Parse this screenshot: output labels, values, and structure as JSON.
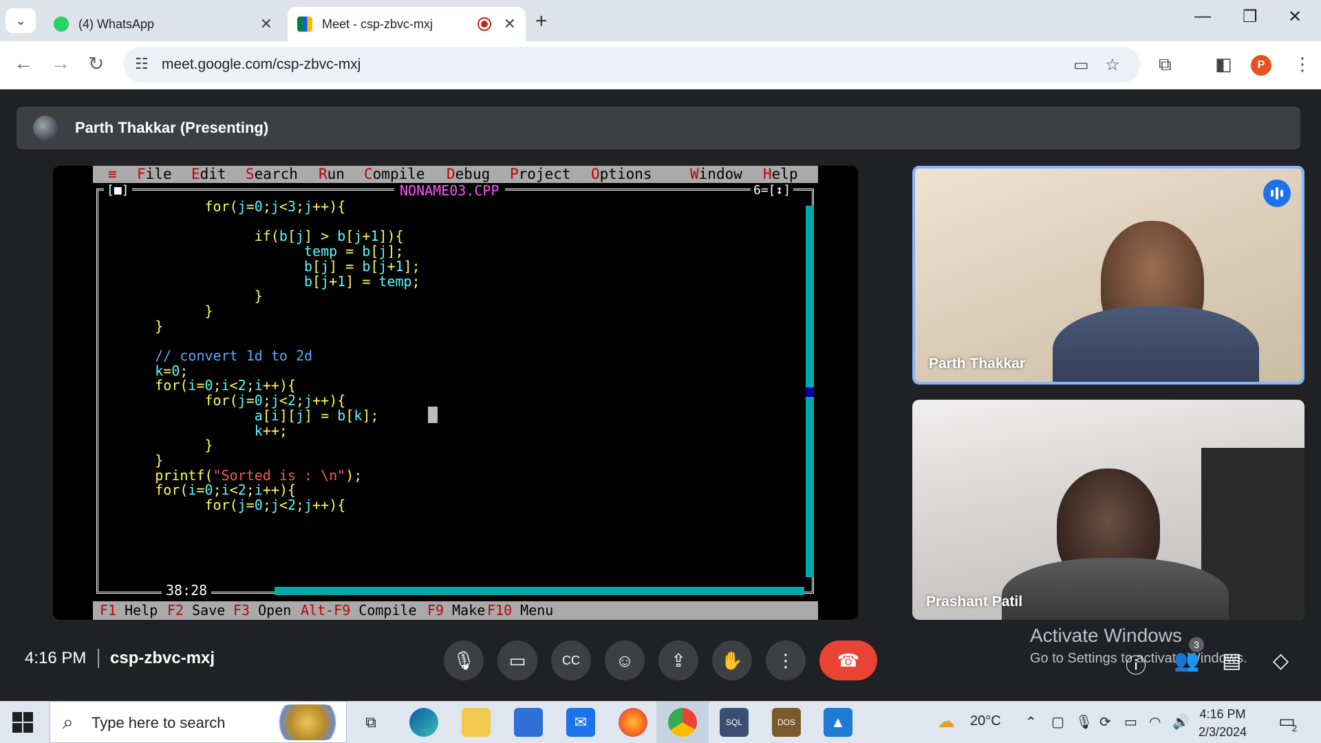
{
  "browser": {
    "tabs": [
      {
        "title": "(4) WhatsApp",
        "active": false
      },
      {
        "title": "Meet - csp-zbvc-mxj",
        "active": true
      }
    ],
    "url": "meet.google.com/csp-zbvc-mxj",
    "profile_initial": "P"
  },
  "meet": {
    "presenter_label": "Parth Thakkar (Presenting)",
    "time": "4:16 PM",
    "code": "csp-zbvc-mxj",
    "participants": [
      {
        "name": "Parth Thakkar",
        "speaking": true
      },
      {
        "name": "Prashant Patil",
        "speaking": false
      }
    ],
    "people_count": "3",
    "watermark_line1": "Activate Windows",
    "watermark_line2": "Go to Settings to activate Windows."
  },
  "ide": {
    "menu": [
      "≡",
      "File",
      "Edit",
      "Search",
      "Run",
      "Compile",
      "Debug",
      "Project",
      "Options",
      "Window",
      "Help"
    ],
    "filename": "NONAME03.CPP",
    "window_left": "[■]",
    "window_right": "6=[↕]",
    "cursor_pos": "38:28",
    "fkeys": [
      {
        "key": "F1",
        "label": "Help"
      },
      {
        "key": "F2",
        "label": "Save"
      },
      {
        "key": "F3",
        "label": "Open"
      },
      {
        "key": "Alt-F9",
        "label": "Compile"
      },
      {
        "key": "F9",
        "label": "Make"
      },
      {
        "key": "F10",
        "label": "Menu"
      }
    ],
    "code_lines": [
      "            for(j=0;j<3;j++){",
      "",
      "                  if(b[j] > b[j+1]){",
      "                        temp = b[j];",
      "                        b[j] = b[j+1];",
      "                        b[j+1] = temp;",
      "                  }",
      "            }",
      "      }",
      "",
      "      // convert 1d to 2d",
      "      k=0;",
      "      for(i=0;i<2;i++){",
      "            for(j=0;j<2;j++){",
      "                  a[i][j] = b[k];",
      "                  k++;",
      "            }",
      "      }",
      "      printf(\"Sorted is : \\n\");",
      "      for(i=0;i<2;i++){",
      "            for(j=0;j<2;j++){"
    ]
  },
  "taskbar": {
    "search_placeholder": "Type here to search",
    "weather": "20°C",
    "clock_time": "4:16 PM",
    "clock_date": "2/3/2024",
    "notification_count": "2"
  }
}
